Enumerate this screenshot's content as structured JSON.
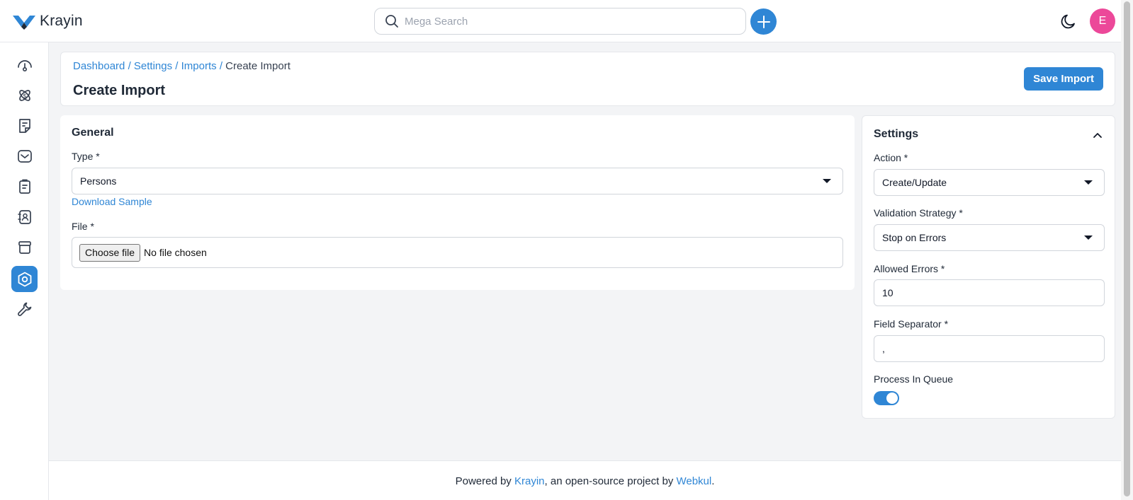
{
  "app": {
    "logo_text": "Krayin",
    "brand_color": "#2f86d5",
    "avatar_color": "#ec4899"
  },
  "header": {
    "search_placeholder": "Mega Search",
    "avatar_initial": "E"
  },
  "sidebar": {
    "items": [
      {
        "icon": "dashboard-icon"
      },
      {
        "icon": "leads-icon"
      },
      {
        "icon": "quotes-icon"
      },
      {
        "icon": "mail-icon"
      },
      {
        "icon": "activities-icon"
      },
      {
        "icon": "contacts-icon"
      },
      {
        "icon": "products-icon"
      },
      {
        "icon": "settings-icon",
        "active": true
      },
      {
        "icon": "configuration-icon"
      }
    ]
  },
  "breadcrumb": {
    "items": [
      "Dashboard",
      "Settings",
      "Imports"
    ],
    "current": "Create Import",
    "separator": "/"
  },
  "page": {
    "title": "Create Import",
    "save_label": "Save Import"
  },
  "general": {
    "title": "General",
    "type_label": "Type *",
    "type_value": "Persons",
    "download_sample": "Download Sample",
    "file_label": "File *",
    "file_button": "Choose file",
    "file_status": "No file chosen"
  },
  "settings": {
    "title": "Settings",
    "action_label": "Action *",
    "action_value": "Create/Update",
    "validation_label": "Validation Strategy *",
    "validation_value": "Stop on Errors",
    "allowed_errors_label": "Allowed Errors *",
    "allowed_errors_value": "10",
    "field_separator_label": "Field Separator *",
    "field_separator_value": ",",
    "process_queue_label": "Process In Queue",
    "process_queue_on": true
  },
  "footer": {
    "prefix": "Powered by ",
    "krayin_link": "Krayin",
    "middle": ", an open-source project by ",
    "webkul_link": "Webkul",
    "suffix": "."
  }
}
